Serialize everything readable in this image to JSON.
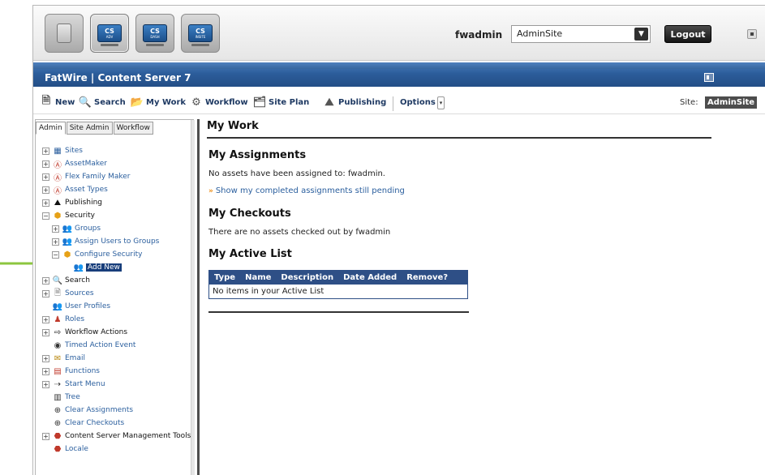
{
  "topbar": {
    "apps": [
      {
        "name": "home",
        "label": ""
      },
      {
        "name": "cs-advanced",
        "label": "CS",
        "sub": "ADV"
      },
      {
        "name": "cs-dash",
        "label": "CS",
        "sub": "DASH"
      },
      {
        "name": "cs-insite",
        "label": "CS",
        "sub": "INSITE"
      }
    ],
    "username": "fwadmin",
    "site_select": "AdminSite",
    "logout_label": "Logout"
  },
  "title": "FatWire | Content Server 7",
  "toolbar": {
    "new_label": "New",
    "search_label": "Search",
    "mywork_label": "My Work",
    "workflow_label": "Workflow",
    "siteplan_label": "Site Plan",
    "publishing_label": "Publishing",
    "options_label": "Options",
    "site_label": "Site:",
    "site_value": "AdminSite"
  },
  "tree": {
    "tabs": [
      "Admin",
      "Site Admin",
      "Workflow"
    ],
    "nodes": [
      {
        "label": "Sites",
        "icon": "sites-icon"
      },
      {
        "label": "AssetMaker",
        "icon": "assetmaker-icon"
      },
      {
        "label": "Flex Family Maker",
        "icon": "flex-family-icon"
      },
      {
        "label": "Asset Types",
        "icon": "asset-types-icon"
      },
      {
        "label": "Publishing",
        "icon": "publishing-icon"
      },
      {
        "label": "Security",
        "icon": "security-icon"
      },
      {
        "label": "Groups",
        "icon": "groups-icon"
      },
      {
        "label": "Assign Users to Groups",
        "icon": "assign-users-icon"
      },
      {
        "label": "Configure Security",
        "icon": "configure-security-icon"
      },
      {
        "label": "Add New",
        "icon": "add-new-icon"
      },
      {
        "label": "Search",
        "icon": "search-icon"
      },
      {
        "label": "Sources",
        "icon": "sources-icon"
      },
      {
        "label": "User Profiles",
        "icon": "user-profiles-icon"
      },
      {
        "label": "Roles",
        "icon": "roles-icon"
      },
      {
        "label": "Workflow Actions",
        "icon": "workflow-actions-icon"
      },
      {
        "label": "Timed Action Event",
        "icon": "timed-action-icon"
      },
      {
        "label": "Email",
        "icon": "email-icon"
      },
      {
        "label": "Functions",
        "icon": "functions-icon"
      },
      {
        "label": "Start Menu",
        "icon": "start-menu-icon"
      },
      {
        "label": "Tree",
        "icon": "tree-icon"
      },
      {
        "label": "Clear Assignments",
        "icon": "clear-assignments-icon"
      },
      {
        "label": "Clear Checkouts",
        "icon": "clear-checkouts-icon"
      },
      {
        "label": "Content Server Management Tools",
        "icon": "management-tools-icon"
      },
      {
        "label": "Locale",
        "icon": "locale-icon"
      }
    ]
  },
  "main": {
    "heading": "My Work",
    "assignments_heading": "My Assignments",
    "assignments_text": "No assets have been assigned to: fwadmin.",
    "pending_link": "Show my completed assignments still pending",
    "checkouts_heading": "My Checkouts",
    "checkouts_text": "There are no assets checked out by fwadmin",
    "active_list_heading": "My Active List",
    "table_headers": [
      "Type",
      "Name",
      "Description",
      "Date Added",
      "Remove?"
    ],
    "table_empty": "No items in your Active List"
  },
  "colors": {
    "title_bar": "#2c5d9b",
    "link": "#2b5f9e",
    "table_header": "#2e4f86",
    "annotation_arrow": "#8cc63f"
  }
}
